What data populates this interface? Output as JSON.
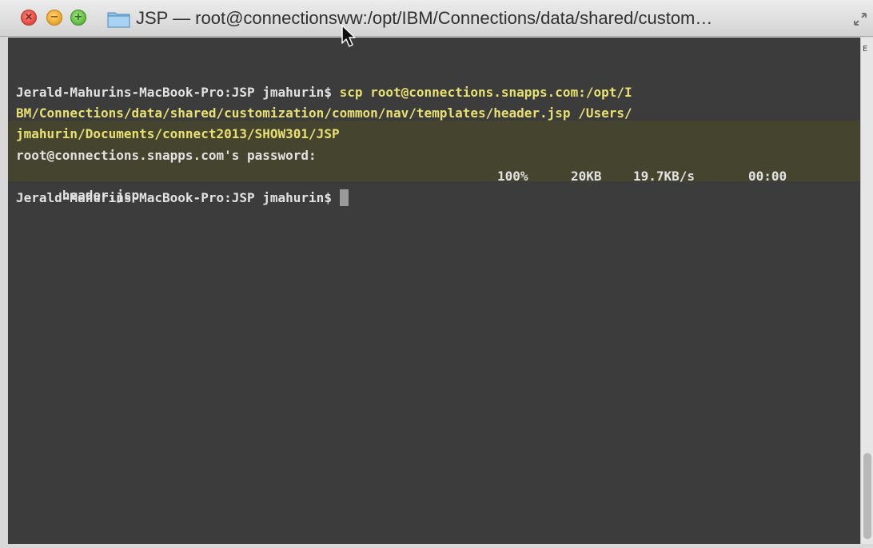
{
  "window": {
    "title": "JSP — root@connectionsww:/opt/IBM/Connections/data/shared/custom…",
    "icons": {
      "close": "close-icon",
      "minimize": "minimize-icon",
      "zoom": "zoom-icon",
      "folder": "folder-icon",
      "resize": "fullscreen-icon",
      "pointer": "mouse-pointer-icon"
    }
  },
  "terminal": {
    "prompt": "Jerald-Mahurins-MacBook-Pro:JSP jmahurin$ ",
    "command_line_1": "scp root@connections.snapps.com:/opt/I",
    "command_line_2": "BM/Connections/data/shared/customization/common/nav/templates/header.jsp /Users/",
    "command_line_3": "jmahurin/Documents/connect2013/SHOW301/JSP",
    "password_prompt": "root@connections.snapps.com's password:",
    "transfer": {
      "file": "header.jsp",
      "percent": "100%",
      "size": "20KB",
      "rate": "19.7KB/s",
      "eta": "00:00"
    },
    "final_prompt": "Jerald-Mahurins-MacBook-Pro:JSP jmahurin$ "
  },
  "scrollbar": {
    "marker": "E"
  },
  "colors": {
    "terminal_bg": "#3c3c3c",
    "command_highlight_bg": "#45452f",
    "command_text": "#e8e070",
    "output_text": "#e2e2e2"
  }
}
